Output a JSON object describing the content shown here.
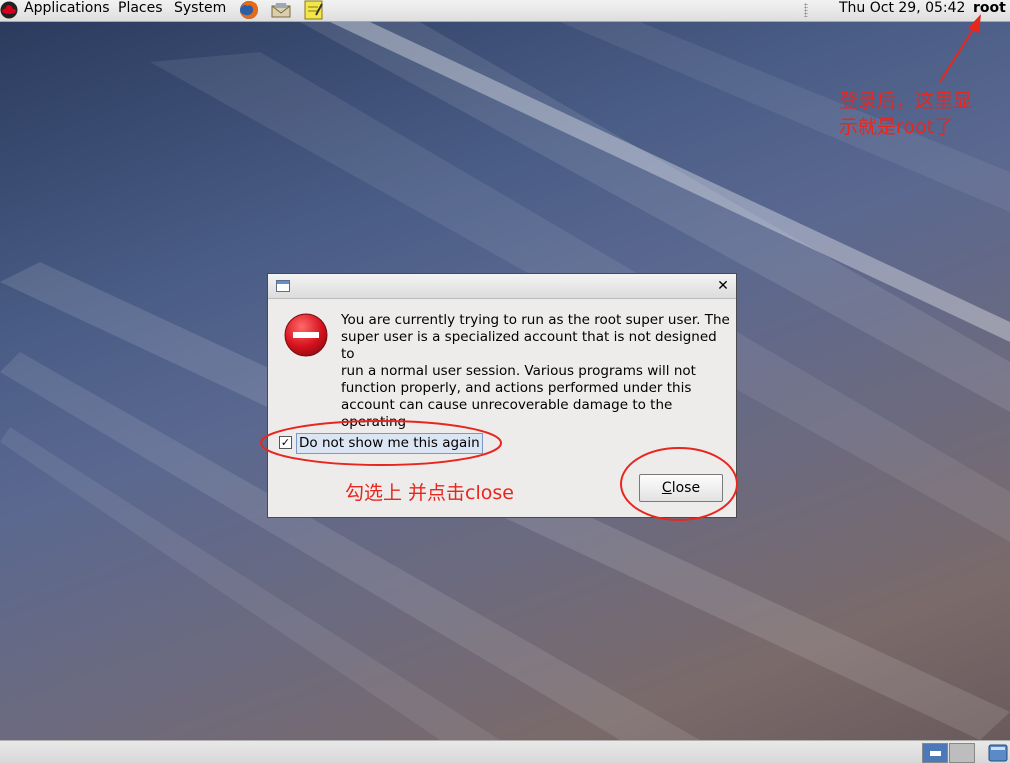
{
  "top_panel": {
    "menus": [
      "Applications",
      "Places",
      "System"
    ],
    "launchers": [
      "firefox-icon",
      "mail-icon",
      "notes-icon"
    ],
    "clock": "Thu Oct 29, 05:42",
    "user": "root"
  },
  "dialog": {
    "close_glyph": "✕",
    "icon": "stop-icon",
    "message": "You are currently trying to run as the root super user.  The\nsuper user is a specialized account that is not designed to\nrun a normal user session.  Various programs will not\nfunction properly, and actions performed under this\naccount can cause unrecoverable damage to the operating\nsystem.",
    "checkbox_label": "Do not show me this again",
    "checkbox_checked": true,
    "close_mnemonic": "C",
    "close_rest": "lose"
  },
  "annotations": {
    "top_right_note": "登录后，这里显\n示就是root了",
    "dialog_note": "勾选上 并点击close",
    "color": "#e8261e"
  },
  "bottom_panel": {
    "workspaces": [
      "workspace-1",
      "workspace-2"
    ],
    "active_workspace": "workspace-1"
  }
}
